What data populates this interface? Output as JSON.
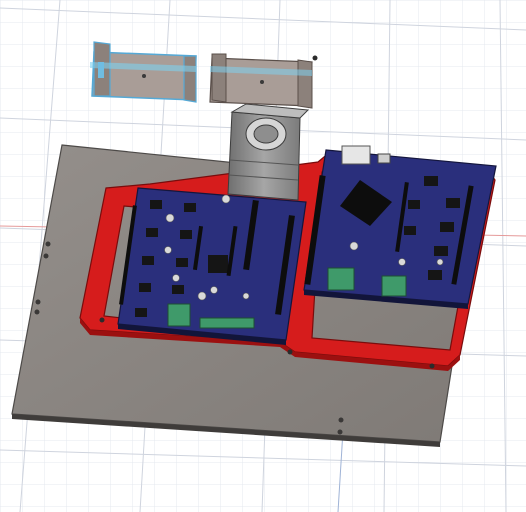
{
  "app": {
    "view": "cad-3d-viewport",
    "visible_text": []
  },
  "scene": {
    "background": "#ffffff",
    "grid_minor_color": "#e2e6ee",
    "grid_major_color": "#c9cfdb",
    "axis_color": "#e07a7a",
    "objects": [
      {
        "name": "base-plate",
        "color": "#8b8580"
      },
      {
        "name": "red-mounting-frame",
        "color": "#d81e1e"
      },
      {
        "name": "left-driver-board",
        "color": "#2a2f78"
      },
      {
        "name": "right-controller-board",
        "color": "#2a2f78"
      },
      {
        "name": "stepper-motor",
        "color": "#9a9a9a"
      },
      {
        "name": "selected-rail-left",
        "color": "#7fd0ee"
      },
      {
        "name": "rail-right",
        "color": "#a89c95"
      },
      {
        "name": "terminal-blocks",
        "color": "#3f9a6a"
      }
    ]
  }
}
